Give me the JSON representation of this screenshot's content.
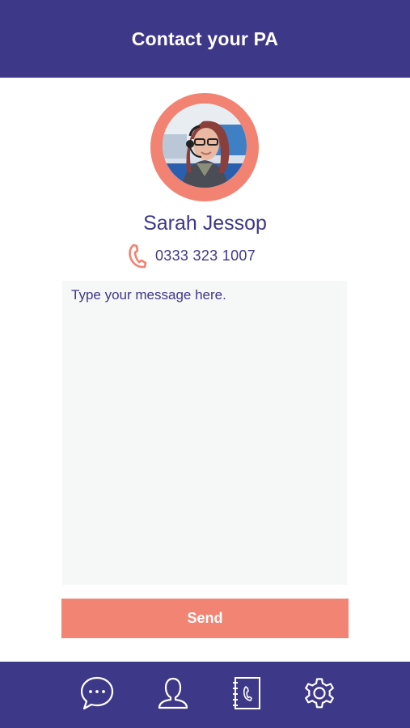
{
  "header": {
    "title": "Contact your PA"
  },
  "pa": {
    "name": "Sarah Jessop",
    "phone": "0333 323 1007"
  },
  "message": {
    "placeholder": "Type your message here."
  },
  "actions": {
    "send_label": "Send"
  },
  "tab_bar": {
    "items": [
      {
        "icon": "chat-bubble-icon"
      },
      {
        "icon": "person-icon"
      },
      {
        "icon": "phone-book-icon"
      },
      {
        "icon": "gear-icon"
      }
    ]
  },
  "colors": {
    "primary": "#3e3888",
    "accent": "#f28272",
    "input_background": "#f6f7f7"
  }
}
